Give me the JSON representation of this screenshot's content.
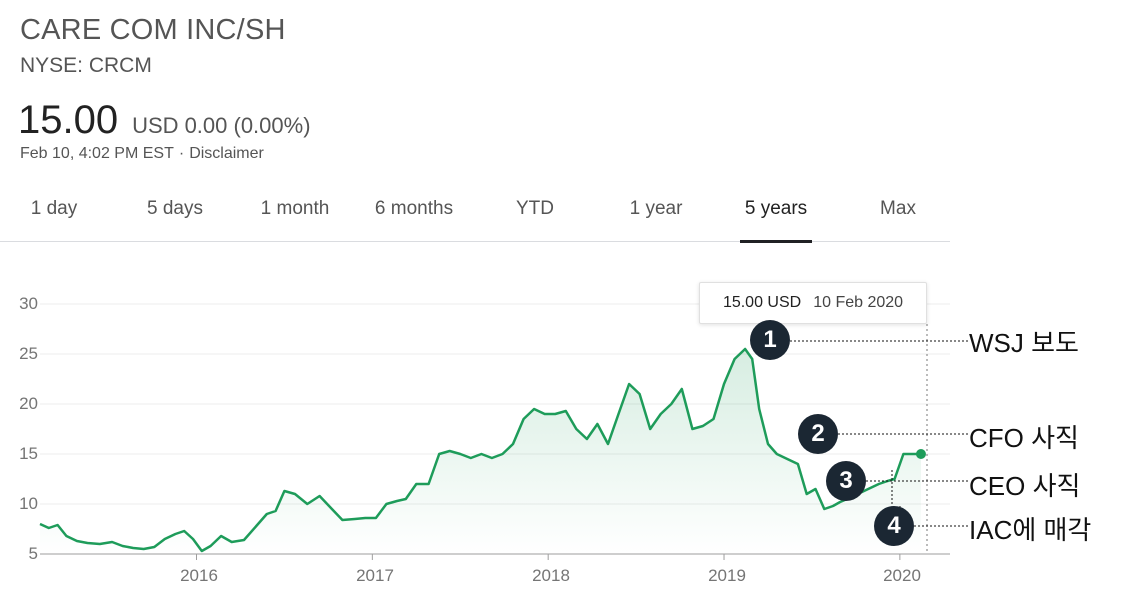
{
  "header": {
    "company": "CARE COM INC/SH",
    "ticker": "NYSE: CRCM",
    "price": "15.00",
    "currency": "USD",
    "change": "0.00 (0.00%)",
    "timestamp": "Feb 10, 4:02 PM EST",
    "disclaimer": "Disclaimer"
  },
  "tabs": [
    {
      "label": "1 day"
    },
    {
      "label": "5 days"
    },
    {
      "label": "1 month"
    },
    {
      "label": "6 months"
    },
    {
      "label": "YTD"
    },
    {
      "label": "1 year"
    },
    {
      "label": "5 years"
    },
    {
      "label": "Max"
    }
  ],
  "active_tab": "5 years",
  "tooltip": {
    "value": "15.00 USD",
    "date": "10 Feb 2020"
  },
  "annotations": [
    {
      "number": "1",
      "label": "WSJ 보도"
    },
    {
      "number": "2",
      "label": "CFO 사직"
    },
    {
      "number": "3",
      "label": "CEO 사직"
    },
    {
      "number": "4",
      "label": "IAC에 매각"
    }
  ],
  "colors": {
    "line": "#1e9c5a",
    "badge": "#1b2733",
    "grid": "#ececec"
  },
  "chart_data": {
    "type": "area",
    "y_ticks": [
      "30",
      "25",
      "20",
      "15",
      "10",
      "5"
    ],
    "x_ticks": [
      "2016",
      "2017",
      "2018",
      "2019",
      "2020"
    ],
    "ylim": [
      5,
      30
    ],
    "xlim": [
      2015.11,
      2020.16
    ],
    "grid": true,
    "series": [
      {
        "x": [
          2015.11,
          2015.16,
          2015.21,
          2015.26,
          2015.32,
          2015.38,
          2015.45,
          2015.52,
          2015.58,
          2015.64,
          2015.7,
          2015.76,
          2015.82,
          2015.88,
          2015.93,
          2015.98,
          2016.03,
          2016.08,
          2016.14,
          2016.2,
          2016.27,
          2016.34,
          2016.4,
          2016.45,
          2016.5,
          2016.56,
          2016.63,
          2016.7,
          2016.77,
          2016.83,
          2016.9,
          2016.96,
          2017.02,
          2017.08,
          2017.14,
          2017.19,
          2017.25,
          2017.32,
          2017.38,
          2017.44,
          2017.5,
          2017.56,
          2017.62,
          2017.68,
          2017.74,
          2017.8,
          2017.86,
          2017.92,
          2017.98,
          2018.04,
          2018.1,
          2018.16,
          2018.22,
          2018.28,
          2018.34,
          2018.4,
          2018.46,
          2018.52,
          2018.58,
          2018.64,
          2018.7,
          2018.76,
          2018.82,
          2018.88,
          2018.94,
          2019.0,
          2019.06,
          2019.12,
          2019.16,
          2019.2,
          2019.25,
          2019.3,
          2019.36,
          2019.42,
          2019.47,
          2019.52,
          2019.57,
          2019.62,
          2019.66,
          2019.7,
          2019.76,
          2019.82,
          2019.88,
          2019.93,
          2019.97,
          2020.02,
          2020.08,
          2020.12
        ],
        "y": [
          8.0,
          7.6,
          7.9,
          6.8,
          6.3,
          6.1,
          6.0,
          6.2,
          5.8,
          5.6,
          5.5,
          5.7,
          6.5,
          7.0,
          7.3,
          6.5,
          5.3,
          5.8,
          6.8,
          6.2,
          6.4,
          7.8,
          9.0,
          9.3,
          11.3,
          11.0,
          10.0,
          10.8,
          9.5,
          8.4,
          8.5,
          8.6,
          8.6,
          10.0,
          10.3,
          10.5,
          12.0,
          12.0,
          15.0,
          15.3,
          15.0,
          14.6,
          15.0,
          14.6,
          15.0,
          16.0,
          18.5,
          19.5,
          19.0,
          19.0,
          19.3,
          17.5,
          16.5,
          18.0,
          16.0,
          19.0,
          22.0,
          21.0,
          17.5,
          19.0,
          20.0,
          21.5,
          17.5,
          17.8,
          18.5,
          22.0,
          24.5,
          25.5,
          24.5,
          19.5,
          16.0,
          15.0,
          14.5,
          14.0,
          11.0,
          11.5,
          9.5,
          9.8,
          10.2,
          10.5,
          11.0,
          11.5,
          12.0,
          12.3,
          12.5,
          15.0,
          15.0,
          15.0
        ]
      }
    ]
  }
}
